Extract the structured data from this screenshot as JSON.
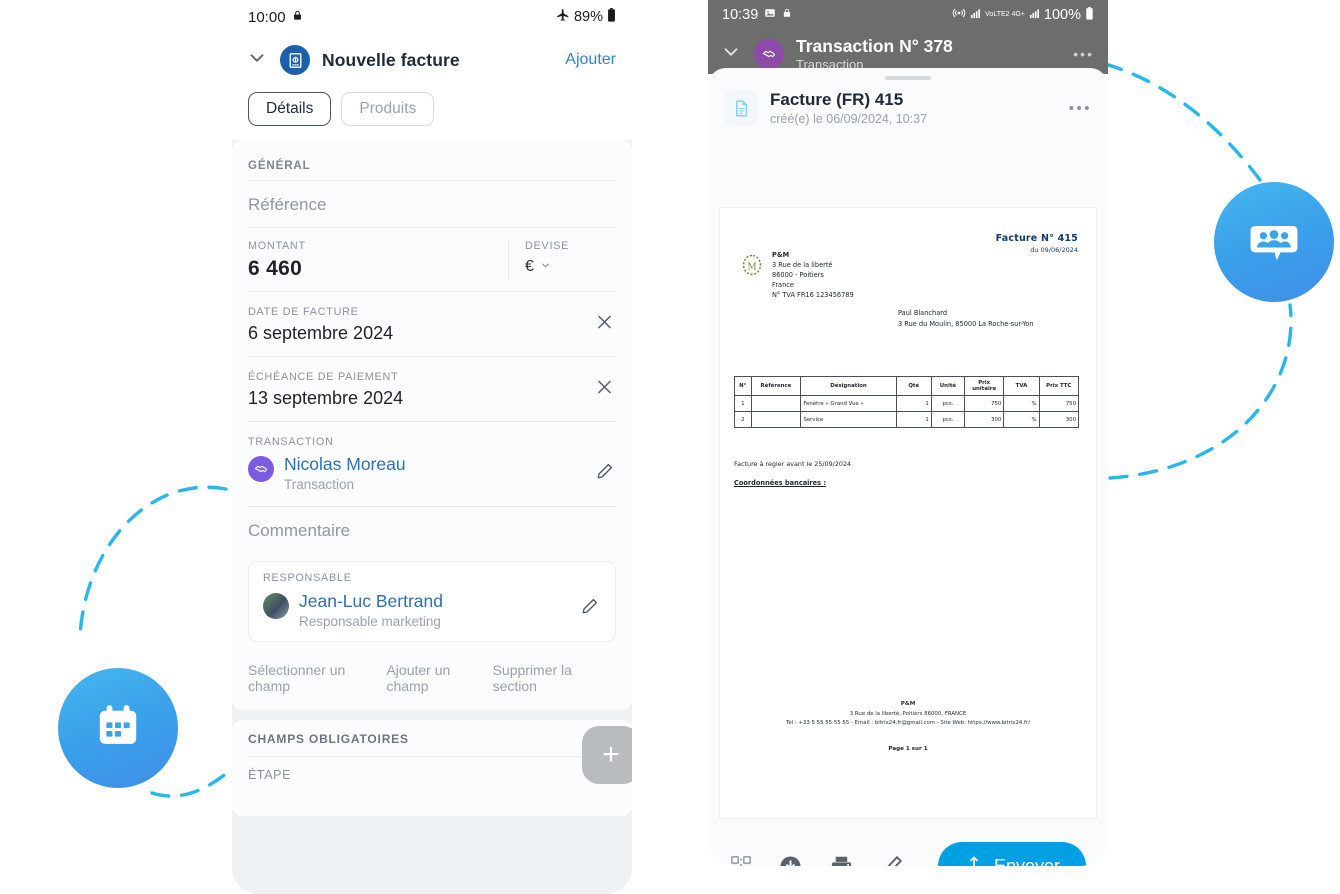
{
  "left_phone": {
    "status_bar": {
      "time": "10:00",
      "lock_icon": "lock-icon",
      "airplane_icon": "airplane-icon",
      "battery": "89%"
    },
    "header": {
      "collapse_icon": "chevron-down-icon",
      "app_icon": "invoice-document-icon",
      "title": "Nouvelle facture",
      "action": "Ajouter"
    },
    "tabs": [
      {
        "label": "Détails",
        "active": true
      },
      {
        "label": "Produits",
        "active": false
      }
    ],
    "section_general": {
      "label": "GÉNÉRAL",
      "reference_placeholder": "Référence",
      "amount_label": "MONTANT",
      "amount_value": "6 460",
      "currency_label": "DEVISE",
      "currency_value": "€",
      "currency_caret": "chevron-down-icon",
      "invoice_date_label": "DATE DE FACTURE",
      "invoice_date_value": "6 septembre 2024",
      "due_date_label": "ÉCHÉANCE DE PAIEMENT",
      "due_date_value": "13 septembre 2024",
      "transaction_label": "TRANSACTION",
      "transaction_name": "Nicolas Moreau",
      "transaction_sub": "Transaction",
      "comment_placeholder": "Commentaire",
      "responsible_label": "RESPONSABLE",
      "responsible_name": "Jean-Luc Bertrand",
      "responsible_role": "Responsable marketing"
    },
    "links": [
      "Sélectionner un champ",
      "Ajouter un champ",
      "Supprimer la section"
    ],
    "section_required": {
      "label": "CHAMPS OBLIGATOIRES",
      "step_label": "ÉTAPE"
    },
    "fab_label": "+"
  },
  "right_phone": {
    "status_bar": {
      "time": "10:39",
      "image_icon": "image-icon",
      "lock_icon": "lock-icon",
      "wifi_icon": "hotspot-icon",
      "network": "VoLTE2 4G+",
      "battery": "100%"
    },
    "header": {
      "collapse_icon": "chevron-down-icon",
      "avatar_icon": "handshake-icon",
      "title": "Transaction N° 378",
      "subtitle": "Transaction",
      "more_icon": "more-horizontal-icon"
    },
    "sheet": {
      "file_icon": "document-icon",
      "file_title": "Facture (FR) 415",
      "file_meta": "créé(e) le 06/09/2024, 10:37",
      "more_icon": "more-horizontal-icon"
    },
    "toolbar": {
      "qr_icon": "qr-code-icon",
      "download_icon": "download-circle-icon",
      "print_icon": "printer-icon",
      "edit_icon": "pencil-icon",
      "send_icon": "upload-icon",
      "send_label": "Envoyer"
    },
    "document": {
      "invoice_title": "Facture N° 415",
      "invoice_date": "du 09/06/2024",
      "seller": [
        "P&M",
        "3 Rue de la liberté",
        "86000 - Poitiers",
        "France",
        "N° TVA FR16 123456789"
      ],
      "buyer": [
        "Paul Blanchard",
        "3 Rue du Moulin, 85000 La Roche-sur-Yon"
      ],
      "table": {
        "headers": [
          "N°",
          "Référence",
          "Désignation",
          "Qté",
          "Unité",
          "Prix unitaire",
          "TVA",
          "Prix TTC"
        ],
        "rows": [
          [
            "1",
            "",
            "Fenêtre « Grand Vue »",
            "1",
            "pcs.",
            "750",
            "%",
            "750"
          ],
          [
            "2",
            "",
            "Service",
            "1",
            "pcs.",
            "300",
            "%",
            "300"
          ]
        ]
      },
      "payment_note": "Facture à regler avant le 25/09/2024",
      "bank_heading": "Coordonnées bancaires :",
      "footer": [
        "P&M",
        "3 Rue de la liberté, Poitiers 86000, FRANCE",
        "Tel : +33 5 55 55 55 55 - Email : bitrix24.fr@gmail.com - Site Web: https://www.bitrix24.fr/"
      ],
      "page_number": "Page 1 sur 1"
    }
  },
  "decorations": {
    "calendar_badge": "calendar-icon",
    "chat_badge": "group-chat-icon",
    "accent_color": "#29b6e8",
    "send_color": "#00a0e3",
    "link_color": "#2f82d4"
  }
}
